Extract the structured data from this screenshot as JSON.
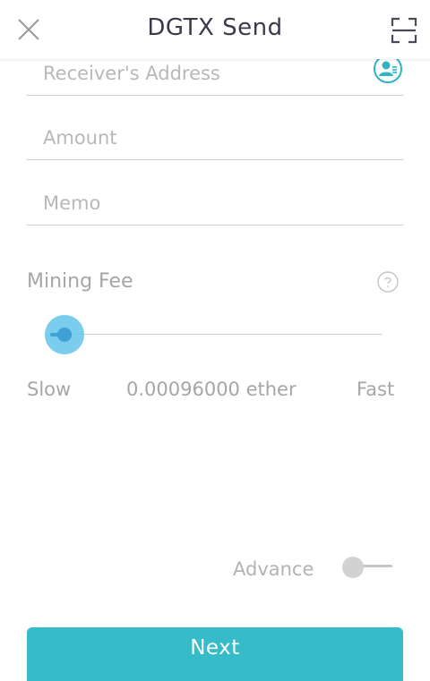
{
  "header": {
    "title": "DGTX Send",
    "close_icon": "close-icon",
    "scan_icon": "scan-icon"
  },
  "form": {
    "receiver_placeholder": "Receiver's Address",
    "amount_placeholder": "Amount",
    "memo_placeholder": "Memo",
    "contact_icon": "contact-book-icon"
  },
  "fee": {
    "label": "Mining Fee",
    "help_icon": "question-icon",
    "slow_label": "Slow",
    "fast_label": "Fast",
    "value": "0.00096000 ether",
    "slider_level": 0
  },
  "advance": {
    "label": "Advance",
    "enabled": false
  },
  "actions": {
    "next_label": "Next"
  },
  "colors": {
    "accent": "#35bcc8",
    "slider_thumb": "#6cc8ea",
    "slider_core": "#2a98d0",
    "text_muted": "#a6a6a6"
  }
}
